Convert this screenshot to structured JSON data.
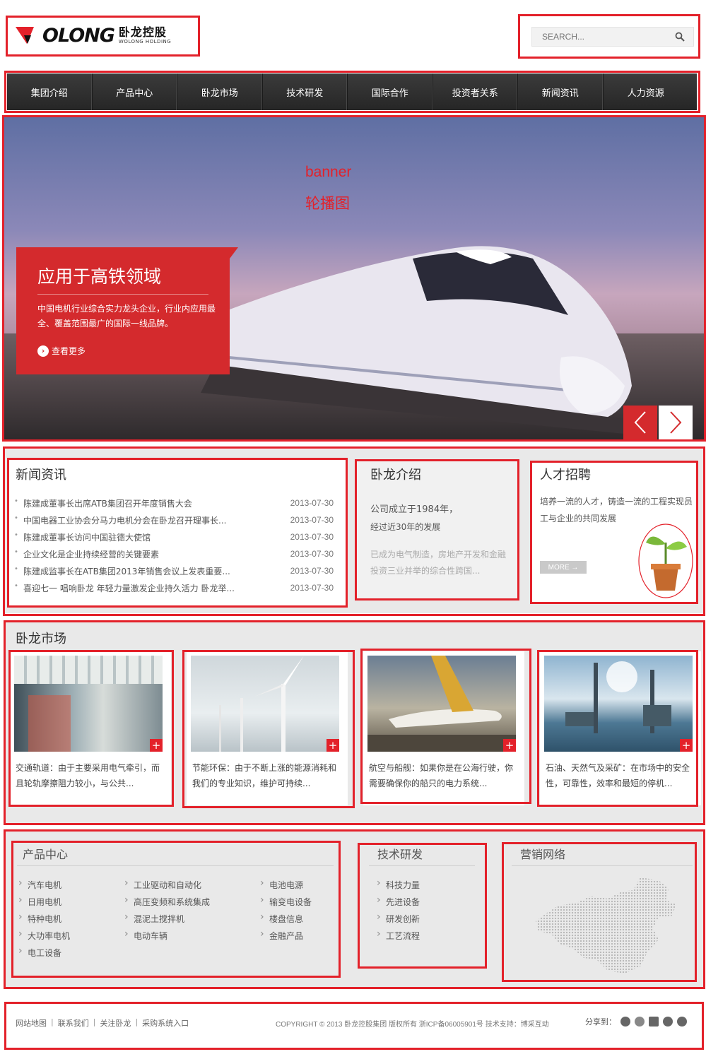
{
  "header": {
    "logo_brand": "OLONG",
    "logo_cn": "卧龙控股",
    "logo_en": "WOLONG HOLDING",
    "search_placeholder": "SEARCH..."
  },
  "nav": [
    "集团介绍",
    "产品中心",
    "卧龙市场",
    "技术研发",
    "国际合作",
    "投资者关系",
    "新闻资讯",
    "人力资源"
  ],
  "banner": {
    "label_line1": "banner",
    "label_line2": "轮播图",
    "title": "应用于高铁领域",
    "desc": "中国电机行业综合实力龙头企业，行业内应用最全、覆盖范围最广的国际一线品牌。",
    "more": "查看更多"
  },
  "news": {
    "title": "新闻资讯",
    "items": [
      {
        "text": "陈建成董事长出席ATB集团召开年度销售大会",
        "date": "2013-07-30"
      },
      {
        "text": "中国电器工业协会分马力电机分会在卧龙召开理事长...",
        "date": "2013-07-30"
      },
      {
        "text": "陈建成董事长访问中国驻德大使馆",
        "date": "2013-07-30"
      },
      {
        "text": "企业文化是企业持续经营的关键要素",
        "date": "2013-07-30"
      },
      {
        "text": "陈建成监事长在ATB集团2013年销售会议上发表重要...",
        "date": "2013-07-30"
      },
      {
        "text": "喜迎七一 唱响卧龙 年轻力量激发企业持久活力 卧龙举...",
        "date": "2013-07-30"
      }
    ]
  },
  "about": {
    "title": "卧龙介绍",
    "line1": "公司成立于1984年，",
    "line2": "经过近30年的发展",
    "line3": "已成为电气制造，房地产开发和金融投资三业并举的综合性跨国..."
  },
  "jobs": {
    "title": "人才招聘",
    "desc": "培养一流的人才，铸造一流的工程实现员工与企业的共同发展",
    "more": "MORE →"
  },
  "market": {
    "title": "卧龙市场",
    "cards": [
      {
        "text": "交通轨道：由于主要采用电气牵引，而且轮轨摩擦阻力较小，与公共..."
      },
      {
        "text": "节能环保：由于不断上涨的能源消耗和我们的专业知识，维护可持续..."
      },
      {
        "text": "航空与船舰：如果你是在公海行驶，你需要确保你的船只的电力系统..."
      },
      {
        "text": "石油、天然气及采矿：在市场中的安全性，可靠性，效率和最短的停机..."
      }
    ],
    "plus": "+"
  },
  "products": {
    "title": "产品中心",
    "col1": [
      "汽车电机",
      "日用电机",
      "特种电机",
      "大功率电机",
      "电工设备"
    ],
    "col2": [
      "工业驱动和自动化",
      "高压变频和系统集成",
      "混泥土搅拌机",
      "电动车辆"
    ],
    "col3": [
      "电池电源",
      "输变电设备",
      "楼盘信息",
      "金融产品"
    ]
  },
  "tech": {
    "title": "技术研发",
    "items": [
      "科技力量",
      "先进设备",
      "研发创新",
      "工艺流程"
    ]
  },
  "network": {
    "title": "营销网络"
  },
  "footer": {
    "links": [
      "网站地图",
      "联系我们",
      "关注卧龙",
      "采购系统入口"
    ],
    "copyright": "COPYRIGHT © 2013 卧龙控股集团 版权所有 浙ICP备06005901号 技术支持：博采互动",
    "share": "分享到："
  },
  "colors": {
    "accent": "#e3212a",
    "nav_bg": "#2e2e2e",
    "section_bg": "#e9e9e9"
  }
}
